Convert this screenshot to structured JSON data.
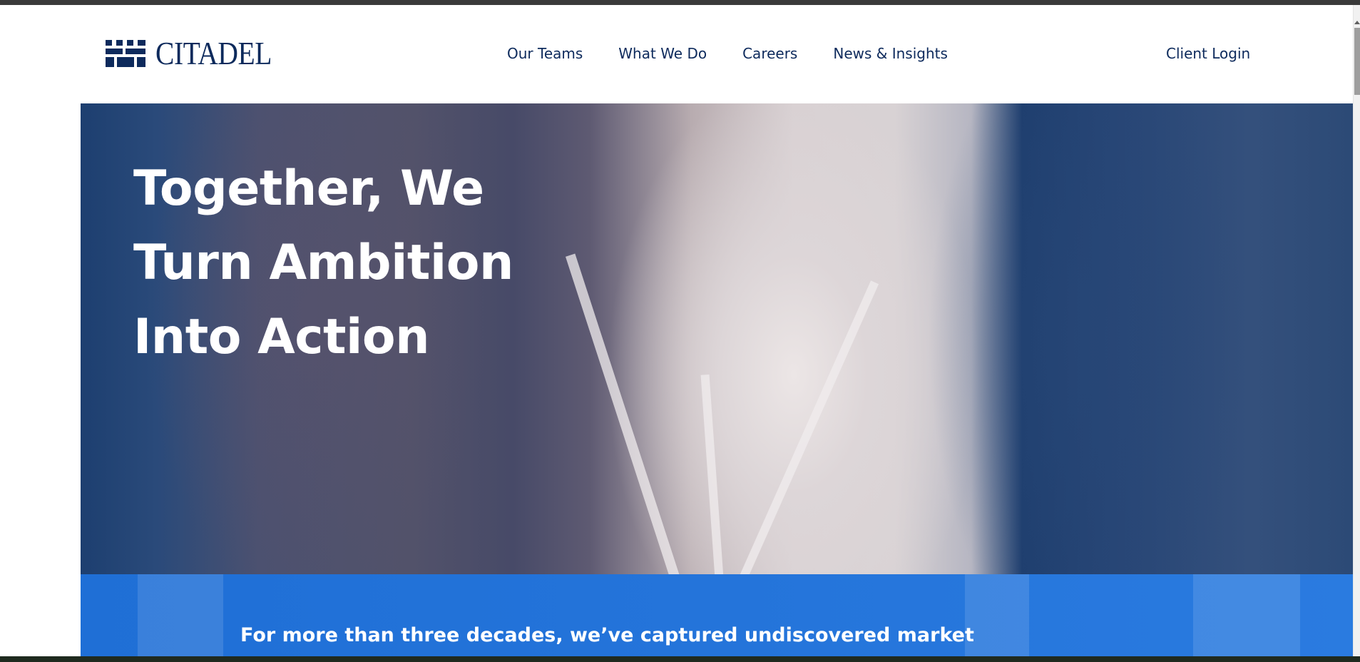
{
  "brand": {
    "name": "CITADEL",
    "color": "#0d2a5c"
  },
  "nav": {
    "items": [
      {
        "label": "Our Teams"
      },
      {
        "label": "What We Do"
      },
      {
        "label": "Careers"
      },
      {
        "label": "News & Insights"
      }
    ],
    "client_login": "Client Login"
  },
  "hero": {
    "title_lines": [
      "Together, We",
      "Turn Ambition",
      "Into Action"
    ],
    "band_text": "For more than three decades, we’ve captured undiscovered market",
    "band_color": "#2474da"
  },
  "icons": {
    "logo": "castle-battlement-icon"
  }
}
